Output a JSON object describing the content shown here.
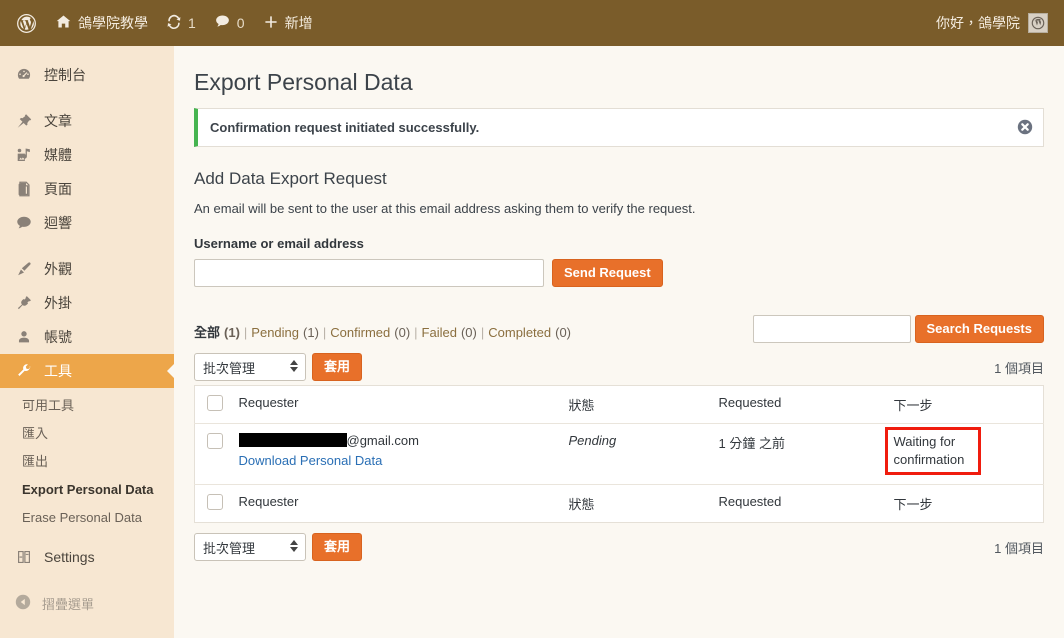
{
  "adminbar": {
    "logo_icon": "wordpress-logo-icon",
    "site_name": "鴿學院教學",
    "home_icon": "home-icon",
    "updates_icon": "updates-icon",
    "updates_count": "1",
    "comments_icon": "comment-bubble-icon",
    "comments_count": "0",
    "new_icon": "plus-icon",
    "new_label": "新增",
    "howdy": "你好，鴿學院",
    "avatar_icon": "user-avatar-icon"
  },
  "sidebar": {
    "items": [
      {
        "label": "控制台",
        "icon": "dashboard-icon",
        "name": "dashboard"
      },
      {
        "label": "文章",
        "icon": "pin-icon",
        "name": "posts"
      },
      {
        "label": "媒體",
        "icon": "media-icon",
        "name": "media"
      },
      {
        "label": "頁面",
        "icon": "pages-icon",
        "name": "pages"
      },
      {
        "label": "迴響",
        "icon": "comment-icon",
        "name": "comments"
      },
      {
        "label": "外觀",
        "icon": "appearance-brush-icon",
        "name": "appearance"
      },
      {
        "label": "外掛",
        "icon": "plugin-icon",
        "name": "plugins"
      },
      {
        "label": "帳號",
        "icon": "user-icon",
        "name": "users"
      },
      {
        "label": "工具",
        "icon": "wrench-icon",
        "name": "tools"
      },
      {
        "label": "Settings",
        "icon": "settings-sliders-icon",
        "name": "settings"
      }
    ],
    "tools_submenu": [
      {
        "label": "可用工具",
        "current": false
      },
      {
        "label": "匯入",
        "current": false
      },
      {
        "label": "匯出",
        "current": false
      },
      {
        "label": "Export Personal Data",
        "current": true
      },
      {
        "label": "Erase Personal Data",
        "current": false
      }
    ],
    "collapse": {
      "label": "摺疊選單",
      "icon": "collapse-arrow-icon"
    }
  },
  "page": {
    "title": "Export Personal Data"
  },
  "notice": {
    "message": "Confirmation request initiated successfully.",
    "accent_color": "#46b450",
    "dismiss_icon": "dismiss-x-icon"
  },
  "add_request": {
    "heading": "Add Data Export Request",
    "description": "An email will be sent to the user at this email address asking them to verify the request.",
    "field_label": "Username or email address",
    "input_value": "",
    "input_placeholder": "",
    "submit_label": "Send Request"
  },
  "filters": {
    "items": [
      {
        "label": "全部",
        "count": "(1)",
        "current": true
      },
      {
        "label": "Pending",
        "count": "(1)",
        "current": false
      },
      {
        "label": "Confirmed",
        "count": "(0)",
        "current": false
      },
      {
        "label": "Failed",
        "count": "(0)",
        "current": false
      },
      {
        "label": "Completed",
        "count": "(0)",
        "current": false
      }
    ],
    "separator": "|"
  },
  "search": {
    "value": "",
    "placeholder": "",
    "button_label": "Search Requests"
  },
  "tablenav_top": {
    "bulk_label": "批次管理",
    "apply_label": "套用",
    "displaying_num": "1 個項目"
  },
  "tablenav_bottom": {
    "bulk_label": "批次管理",
    "apply_label": "套用",
    "displaying_num": "1 個項目"
  },
  "table": {
    "columns": {
      "requester": "Requester",
      "status": "狀態",
      "requested": "Requested",
      "next_steps": "下一步"
    },
    "rows": [
      {
        "requester_redacted": true,
        "requester_email_suffix": "@gmail.com",
        "row_action": "Download Personal Data",
        "status": "Pending",
        "requested": "1 分鐘 之前",
        "next_steps": "Waiting for confirmation",
        "next_steps_highlight_color": "#f01c0e"
      }
    ]
  },
  "colors": {
    "adminbar_bg": "#7a5c2a",
    "sidebar_bg": "#f7e7d2",
    "active_menu_bg": "#eda64a",
    "primary_button": "#e8702a",
    "page_bg": "#fbf8f2",
    "link": "#2a6fb5"
  }
}
